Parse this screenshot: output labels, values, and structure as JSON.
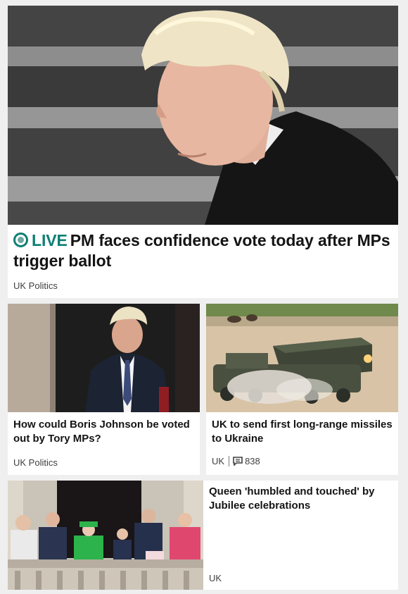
{
  "top_story": {
    "live_label": "LIVE",
    "headline": "PM faces confidence vote today after MPs trigger ballot",
    "tag": "UK Politics"
  },
  "stories": [
    {
      "headline": "How could Boris Johnson be voted out by Tory MPs?",
      "tag": "UK Politics"
    },
    {
      "headline": "UK to send first long-range missiles to Ukraine",
      "tag": "UK",
      "comments": "838"
    },
    {
      "headline": "Queen 'humbled and touched' by Jubilee celebrations",
      "tag": "UK"
    }
  ],
  "colors": {
    "live_accent": "#0d7f73",
    "background": "#efefef",
    "card": "#ffffff"
  }
}
